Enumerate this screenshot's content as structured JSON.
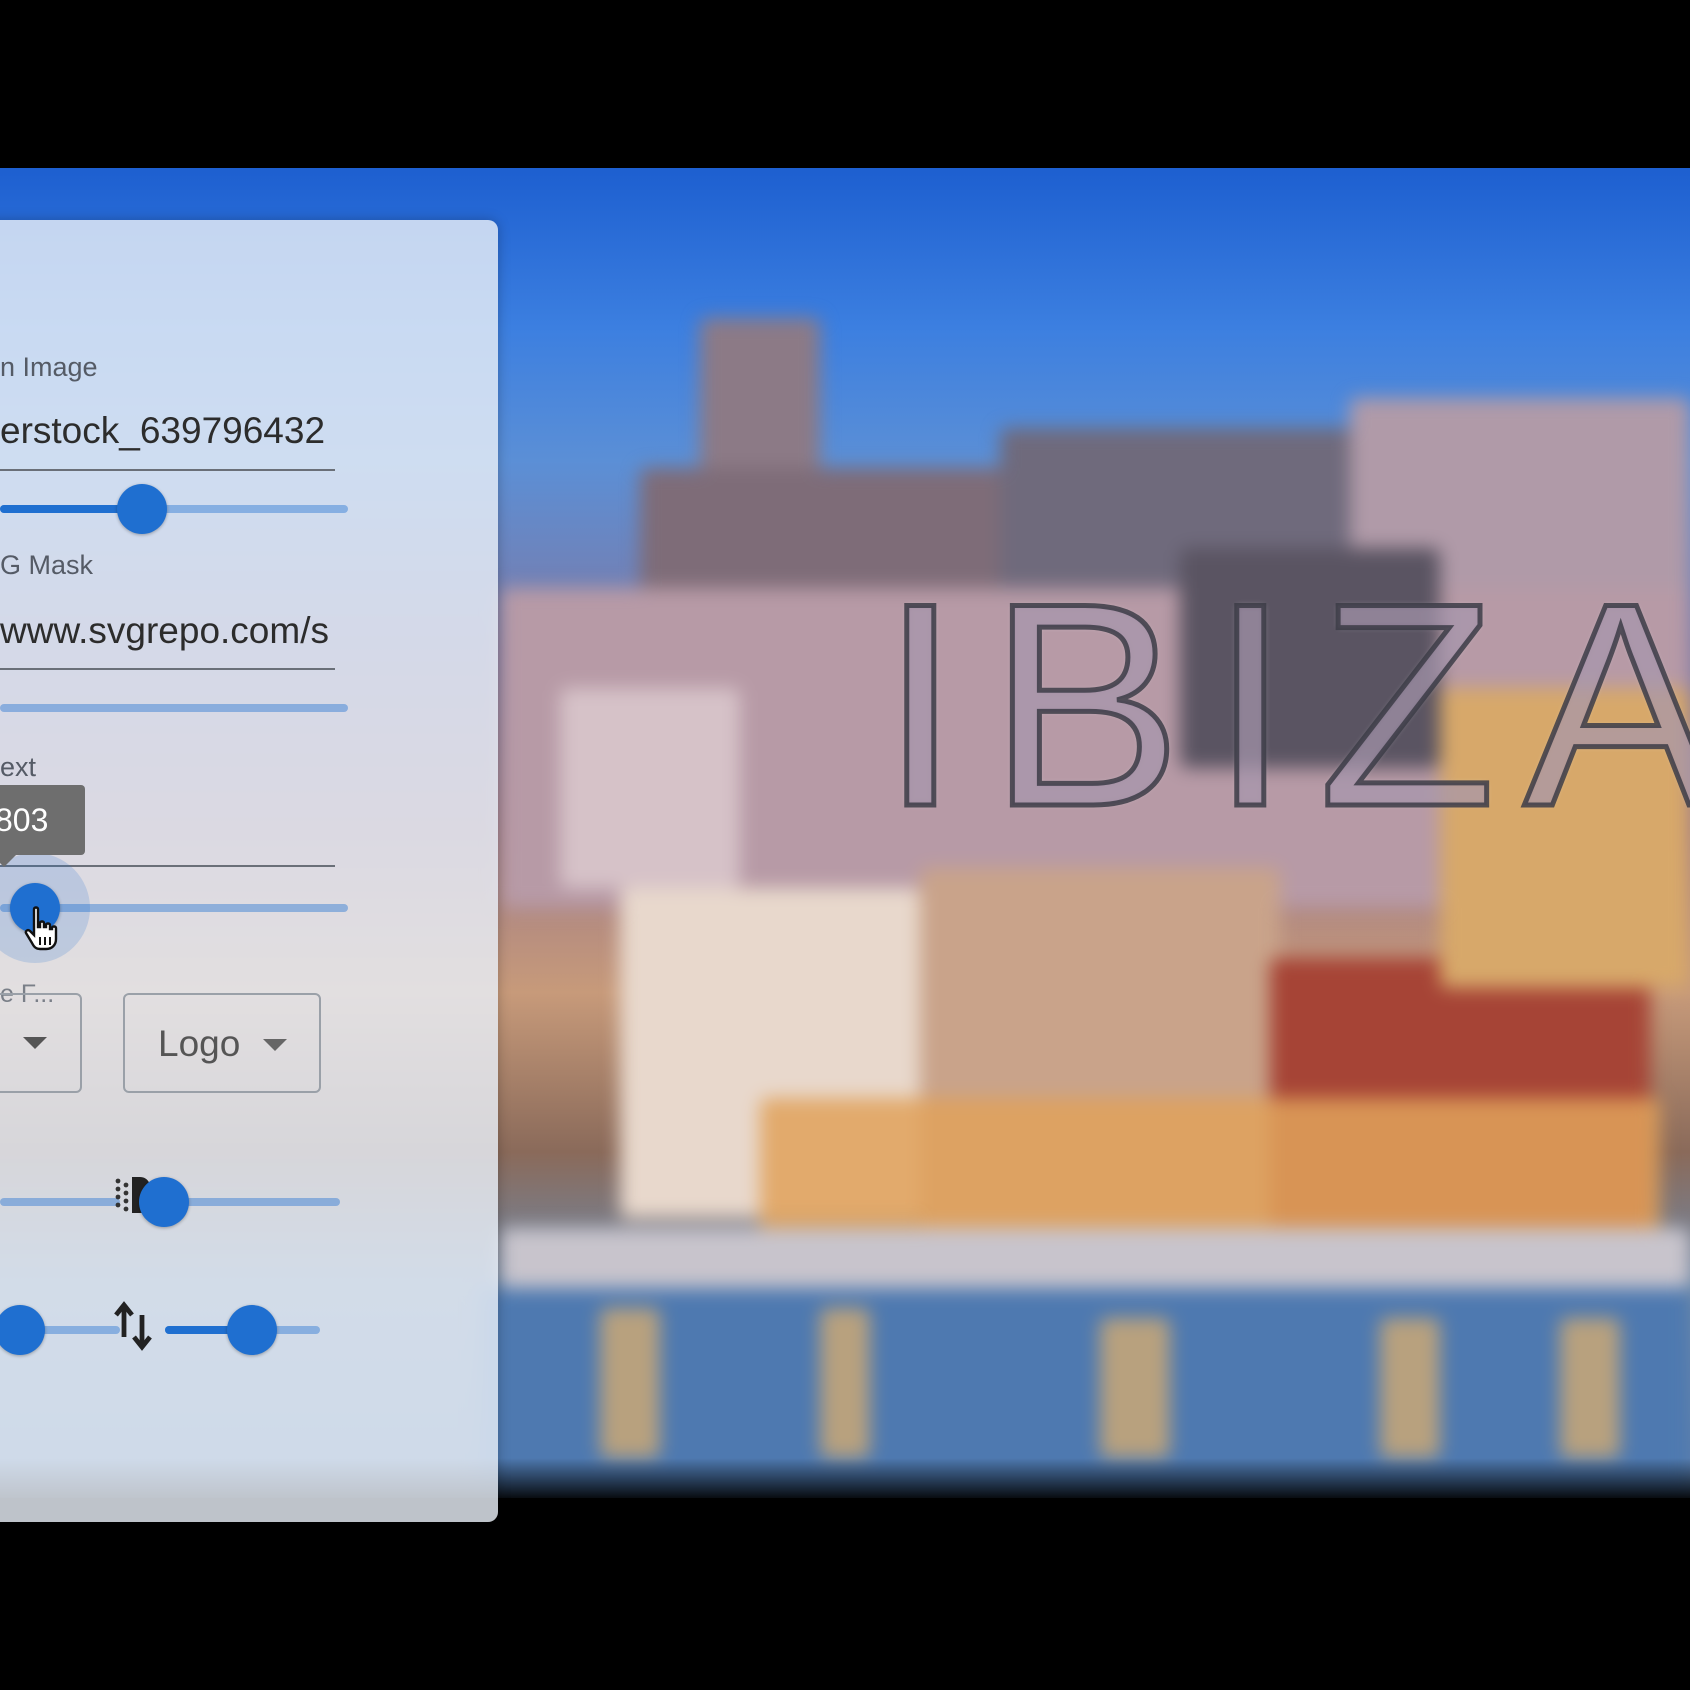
{
  "scene": {
    "overlay_text": "IBIZA"
  },
  "panel": {
    "background_image": {
      "label": "n Image",
      "value": "erstock_639796432"
    },
    "svg_mask": {
      "label": "G Mask",
      "value": "www.svgrepo.com/s"
    },
    "text_field": {
      "label": "ext",
      "tooltip_value": "803"
    },
    "font_select": {
      "label": "e F..."
    },
    "logo_select": {
      "value": "Logo"
    }
  },
  "colors": {
    "accent": "#1f6fd0",
    "panel_bg": "#e8eef7",
    "tooltip_bg": "#6e6e6e"
  }
}
